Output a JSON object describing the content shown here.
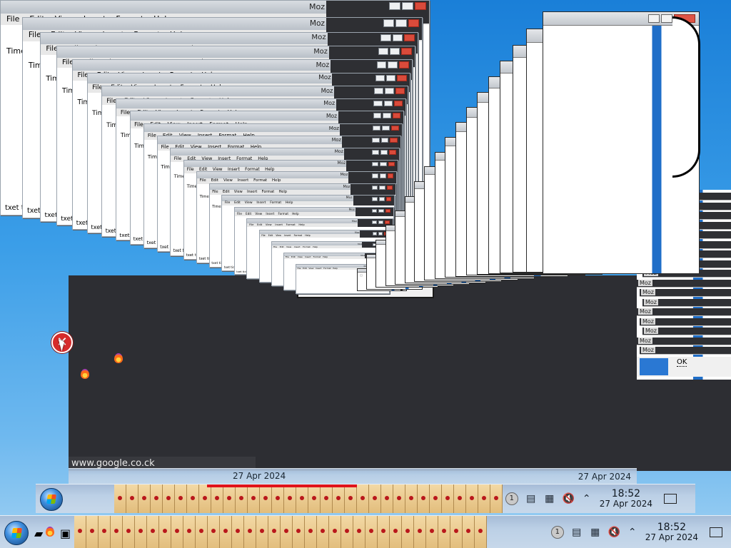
{
  "window": {
    "title_short": "Moz",
    "menu": [
      "File",
      "Edit",
      "View",
      "Insert",
      "Format",
      "Help"
    ],
    "font_box": "Times",
    "status_text": "txet tide"
  },
  "dialog": {
    "ok_label": "OK"
  },
  "status_url": "www.google.co.ck",
  "taskbar": {
    "time": "18:52",
    "date": "27 Apr 2024",
    "badge": "1"
  },
  "icons": {
    "error": "error-icon",
    "firefox": "firefox-icon",
    "start": "start-orb-icon",
    "volume": "volume-muted-icon",
    "clipboard": "clipboard-icon",
    "show_desktop": "show-desktop-icon",
    "tray_arrow": "chevron-up-icon"
  },
  "colors": {
    "desktop": "#1a7fd8",
    "dark_panel": "#2d2e33",
    "dialog_blue": "#2a78d3",
    "error_red": "#d62b2b"
  }
}
